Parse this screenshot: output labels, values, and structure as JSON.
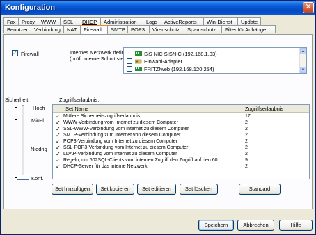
{
  "window": {
    "title": "Konfiguration",
    "close_label": "✕"
  },
  "tabs_row1": [
    {
      "label": "Fax"
    },
    {
      "label": "Proxy"
    },
    {
      "label": "WWW"
    },
    {
      "label": "SSL"
    },
    {
      "label": "DHCP"
    },
    {
      "label": "Administration"
    },
    {
      "label": "Logs"
    },
    {
      "label": "ActiveReports"
    },
    {
      "label": "Win-Dienst"
    },
    {
      "label": "Update"
    }
  ],
  "tabs_row2": [
    {
      "label": "Benutzer"
    },
    {
      "label": "Verbindung"
    },
    {
      "label": "NAT"
    },
    {
      "label": "Firewall",
      "active": true
    },
    {
      "label": "SMTP"
    },
    {
      "label": "POP3"
    },
    {
      "label": "Virenschutz"
    },
    {
      "label": "Spamschutz"
    },
    {
      "label": "Filter für Anhänge"
    }
  ],
  "firewall": {
    "enabled_label": "Firewall",
    "enabled": true
  },
  "internal_network": {
    "label_line1": "Internes Netzwerk definieren",
    "label_line2": "(prüft interne Schnittstellen)",
    "items": [
      {
        "label": "SiS NIC SISNIC (192.168.1.33)",
        "checked": false
      },
      {
        "label": "Einwahl-Adapter",
        "checked": false
      },
      {
        "label": "FRITZ!web (192.168.120.254)",
        "checked": false
      }
    ]
  },
  "security": {
    "label": "Sicherheit",
    "levels": {
      "high": "Hoch",
      "medium": "Mittel",
      "low": "Niedrig",
      "custom": "Konf."
    },
    "level_value": "Konf."
  },
  "access": {
    "label": "Zugriffserlaubnis:",
    "columns": {
      "name": "Set Name",
      "count": "Zugriffserlaubnis"
    },
    "rows": [
      {
        "name": "Mittlere Sicherheitszugriffserlaubnis",
        "count": "17",
        "checked": true
      },
      {
        "name": "WWW-Verbindung vom Internet zu diesem Computer",
        "count": "2",
        "checked": true
      },
      {
        "name": "SSL-WWW-Verbindung vom Internet zu diesem Computer",
        "count": "2",
        "checked": true
      },
      {
        "name": "SMTP-Verbindung zum Internet von diesem Computer",
        "count": "2",
        "checked": true
      },
      {
        "name": "POP3-Verbindung vom Internet zu diesem Computer",
        "count": "2",
        "checked": true
      },
      {
        "name": "SSL-POP3-Verbindung vom Internet zu diesem Computer",
        "count": "2",
        "checked": true
      },
      {
        "name": "LDAP-Verbindung vom Internet zu diesem Computer",
        "count": "2",
        "checked": true
      },
      {
        "name": "Regeln, um 602SQL-Clients vom internen Zugriff den Zugriff auf den 60...",
        "count": "9",
        "checked": true
      },
      {
        "name": "DHCP-Server für das interne Netzwerk",
        "count": "2",
        "checked": true
      }
    ]
  },
  "set_buttons": {
    "add": "Set hinzufügen",
    "copy": "Set kopieren",
    "edit": "Set editieren",
    "delete": "Set löschen",
    "standard": "Standard"
  },
  "dialog_buttons": {
    "save": "Speichern",
    "cancel": "Abbrechen",
    "help": "Hilfe"
  },
  "colors": {
    "title_bar": "#0348c2",
    "tab_highlight": "#e68b2c",
    "check_green": "#21a121"
  },
  "icons": {
    "network": "network-card-icon",
    "dialup": "modem-icon"
  }
}
